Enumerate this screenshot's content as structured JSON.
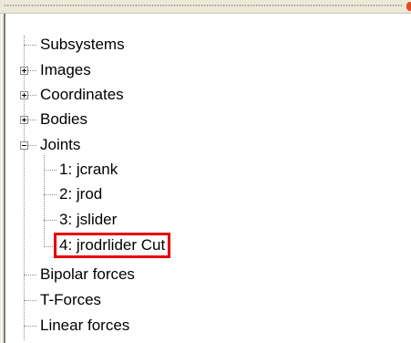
{
  "tree": {
    "items": [
      {
        "label": "Subsystems",
        "state": "leaf"
      },
      {
        "label": "Images",
        "state": "collapsed"
      },
      {
        "label": "Coordinates",
        "state": "collapsed"
      },
      {
        "label": "Bodies",
        "state": "collapsed"
      },
      {
        "label": "Joints",
        "state": "expanded",
        "children": [
          {
            "label": "1: jcrank"
          },
          {
            "label": "2: jrod"
          },
          {
            "label": "3: jslider"
          },
          {
            "label": "4: jrodrlider Cut",
            "highlighted": true
          }
        ]
      },
      {
        "label": "Bipolar forces",
        "state": "leaf"
      },
      {
        "label": "T-Forces",
        "state": "leaf"
      },
      {
        "label": "Linear forces",
        "state": "leaf"
      }
    ]
  },
  "colors": {
    "highlight_border": "#e60000",
    "corner_dot": "#e8471d"
  },
  "icons": {
    "expand": "plus-box-icon",
    "collapse": "minus-box-icon"
  }
}
